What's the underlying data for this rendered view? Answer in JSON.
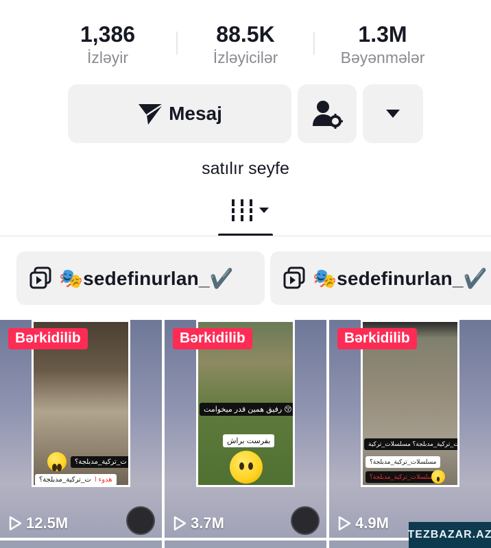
{
  "stats": [
    {
      "value": "1,386",
      "label": "İzləyir"
    },
    {
      "value": "88.5K",
      "label": "İzləyicilər"
    },
    {
      "value": "1.3M",
      "label": "Bəyənmələr"
    }
  ],
  "actions": {
    "message_label": "Mesaj",
    "message_icon": "send-icon",
    "follow_settings_icon": "user-settings-icon",
    "more_icon": "dropdown-arrow-icon"
  },
  "bio": "satılır seyfe",
  "tabs": {
    "active_icon": "videos-grid-icon"
  },
  "playlists": [
    {
      "name": "🎭sedefinurlan_✔️",
      "icon": "playlist-icon"
    },
    {
      "name": "🎭sedefinurlan_✔️",
      "icon": "playlist-icon"
    }
  ],
  "videos": [
    {
      "pin_label": "Bərkidilib",
      "views": "12.5M",
      "captions": [
        "ت_تركية_مدبلجة؟",
        "هدوء الليل",
        "ت_تركية_مدبلجة؟"
      ]
    },
    {
      "pin_label": "Bərkidilib",
      "views": "3.7M",
      "captions": [
        "رفيق همين قدر ميخوامت 😚",
        "بفرست براش"
      ]
    },
    {
      "pin_label": "Bərkidilib",
      "views": "4.9M",
      "captions": [
        "مسلسلات_تركية_مدبلجة؟ مسلسلات_تركية",
        "مسلسلات_تركية_مدبلجة؟",
        "مسلسلات_تركية_مدبلجة؟"
      ]
    }
  ],
  "watermark": "TEZBAZAR.AZ",
  "colors": {
    "accent": "#fe2c55",
    "text": "#161823",
    "muted": "#8a8b91",
    "button_bg": "#f1f1f2"
  }
}
